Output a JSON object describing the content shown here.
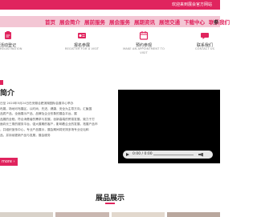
{
  "topbar": {
    "text": "欢迎来到展会官方网站"
  },
  "nav": {
    "items": [
      "首页",
      "展会简介",
      "展前服务",
      "展会服务",
      "展期资讯",
      "展馆交通",
      "下载中心",
      "联系我们"
    ],
    "right": "参"
  },
  "tiles": [
    {
      "label": "活动登记",
      "sub": "REGISTRATION",
      "sub2": ""
    },
    {
      "label": "报名参展",
      "sub": "REGISTER FOR A VISIT",
      "sub2": ""
    },
    {
      "label": "预约参观",
      "sub": "MAKE AN APPOINTMENT TO",
      "sub2": "VISIT"
    },
    {
      "label": "联系我们",
      "sub": "CONTACT US",
      "sub2": ""
    }
  ],
  "intro": {
    "title": "简介",
    "lines": [
      "日至 2020年5月24日在安徽合肥滨湖国际会展中心举办",
      "布展，场地可布展区，以时尚、先进、健康、安全为主导方向，汇聚国",
      "品质产品，全面展示产品、品牌及企业形象的展会平台。展",
      "品展的全程，符合消费者的需求与发展，创新高端的贸易发展，致力于打",
      "面向长三角的服务平台，强大展期的客户，影响着企业的发展，拓展产品市",
      "，并组织宣传中心，专业产品展示，展会期间将安排多场专业论坛和",
      "品，并持续更新产品与发展，展会服务"
    ],
    "more_label": "more"
  },
  "video": {
    "time": "0:00 / 0:00"
  },
  "products": {
    "title": "展品展示"
  },
  "colors": {
    "accent": "#e0245e",
    "nav_bg": "#f3c6d4"
  }
}
